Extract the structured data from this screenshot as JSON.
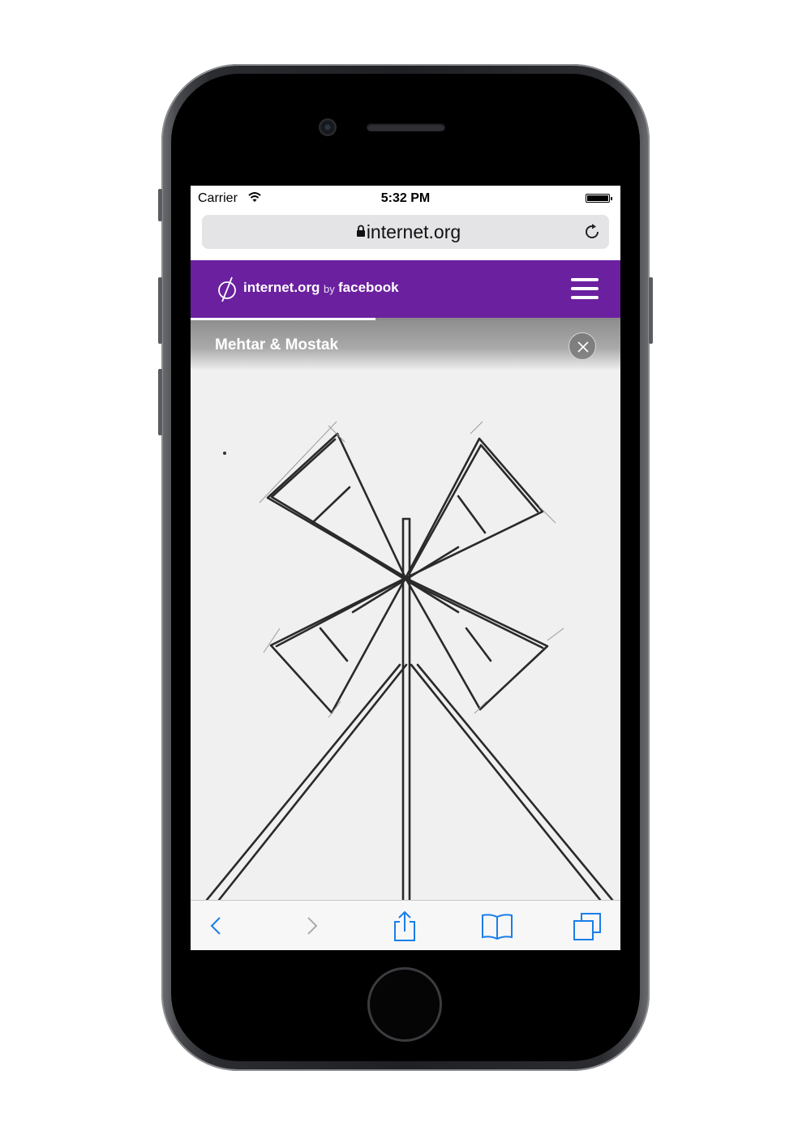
{
  "status_bar": {
    "carrier": "Carrier",
    "time": "5:32 PM"
  },
  "address_bar": {
    "url": "internet.org"
  },
  "site_header": {
    "brand_name": "internet.org",
    "brand_by": "by",
    "brand_company": "facebook",
    "brand_color": "#6b20a0"
  },
  "progress": {
    "value": 0.43
  },
  "story": {
    "title": "Mehtar & Mostak"
  },
  "toolbar": {
    "items": [
      "back-icon",
      "forward-icon",
      "share-icon",
      "bookmarks-icon",
      "tabs-icon"
    ],
    "accent_color": "#1a7ee8"
  }
}
